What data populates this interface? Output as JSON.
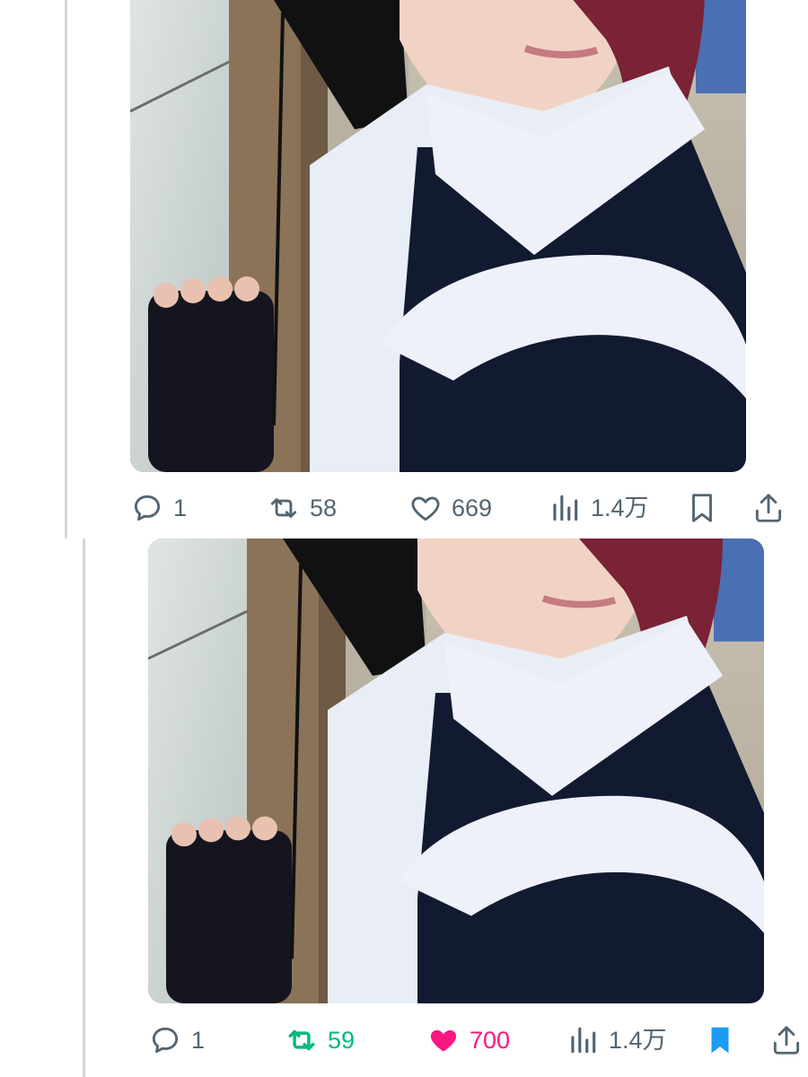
{
  "colors": {
    "muted": "#536471",
    "retweet_active": "#00ba7c",
    "like_active": "#f91880",
    "bookmark_active": "#1d9bf0",
    "thread_line": "#cfd9de"
  },
  "tweets": [
    {
      "photo_alt": "cosplay photo",
      "actions": {
        "reply": {
          "icon": "reply-icon",
          "count": "1"
        },
        "retweet": {
          "icon": "retweet-icon",
          "count": "58",
          "active": false
        },
        "like": {
          "icon": "heart-icon",
          "count": "669",
          "active": false
        },
        "views": {
          "icon": "views-icon",
          "count": "1.4万"
        },
        "bookmark": {
          "icon": "bookmark-icon",
          "active": false
        },
        "share": {
          "icon": "share-icon"
        }
      }
    },
    {
      "photo_alt": "cosplay photo",
      "actions": {
        "reply": {
          "icon": "reply-icon",
          "count": "1"
        },
        "retweet": {
          "icon": "retweet-icon",
          "count": "59",
          "active": true
        },
        "like": {
          "icon": "heart-filled-icon",
          "count": "700",
          "active": true
        },
        "views": {
          "icon": "views-icon",
          "count": "1.4万"
        },
        "bookmark": {
          "icon": "bookmark-filled-icon",
          "active": true
        },
        "share": {
          "icon": "share-icon"
        }
      }
    }
  ]
}
